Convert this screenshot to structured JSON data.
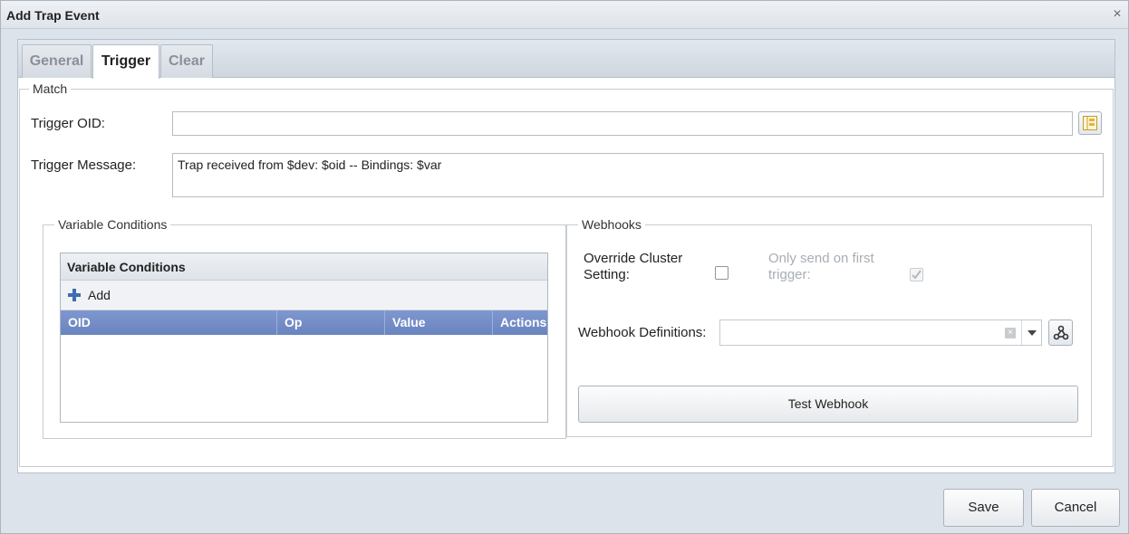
{
  "window": {
    "title": "Add Trap Event",
    "close_glyph": "×"
  },
  "tabs": [
    {
      "label": "General",
      "active": false
    },
    {
      "label": "Trigger",
      "active": true
    },
    {
      "label": "Clear",
      "active": false
    }
  ],
  "match": {
    "legend": "Match",
    "trigger_oid_label": "Trigger OID:",
    "trigger_oid_value": "",
    "oid_browser_icon": "tree-browse-icon",
    "trigger_message_label": "Trigger Message:",
    "trigger_message_value": "Trap received from $dev: $oid -- Bindings: $var"
  },
  "variable_conditions": {
    "legend": "Variable Conditions",
    "grid_title": "Variable Conditions",
    "add_label": "Add",
    "add_icon": "plus-icon",
    "columns": [
      "OID",
      "Op",
      "Value",
      "Actions"
    ],
    "rows": []
  },
  "webhooks": {
    "legend": "Webhooks",
    "override_label_line1": "Override Cluster",
    "override_label_line2": "Setting:",
    "override_checked": false,
    "first_trigger_label_line1": "Only send on first",
    "first_trigger_label_line2": "trigger:",
    "first_trigger_checked": true,
    "definitions_label": "Webhook Definitions:",
    "definitions_value": "",
    "test_button_label": "Test Webhook",
    "webhook_icon": "webhook-icon"
  },
  "footer": {
    "save_label": "Save",
    "cancel_label": "Cancel"
  },
  "colors": {
    "grid_header": "#6f89c5",
    "window_bg": "#dde3ea",
    "add_icon": "#3d6cb3"
  }
}
